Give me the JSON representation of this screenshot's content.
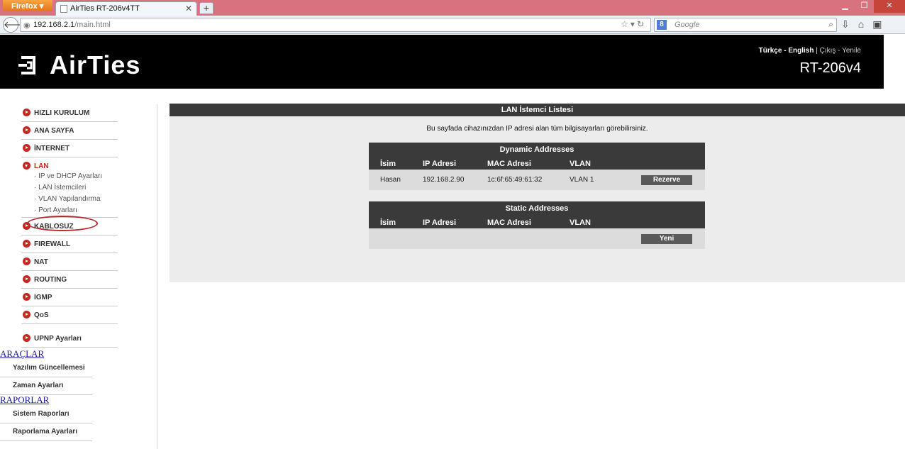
{
  "browser": {
    "menu_button": "Firefox",
    "tab_title": "AirTies RT-206v4TT",
    "url_host": "192.168.2.1",
    "url_path": "/main.html",
    "search_placeholder": "Google",
    "search_engine_glyph": "8"
  },
  "header": {
    "logo_text": "AirTies",
    "lang_turkish": "Türkçe",
    "lang_sep": "-",
    "lang_english": "English",
    "pipe": "|",
    "logout": "Çıkış - Yenile",
    "model": "RT-206v4"
  },
  "sidebar": {
    "menu": [
      {
        "label": "HIZLI KURULUM"
      },
      {
        "label": "ANA SAYFA"
      },
      {
        "label": "İNTERNET"
      },
      {
        "label": "LAN"
      },
      {
        "label": "KABLOSUZ"
      },
      {
        "label": "FIREWALL"
      },
      {
        "label": "NAT"
      },
      {
        "label": "ROUTING"
      },
      {
        "label": "IGMP"
      },
      {
        "label": "QoS"
      },
      {
        "label": "UPNP Ayarları"
      }
    ],
    "lan_sub": [
      "· IP ve DHCP Ayarları",
      "· LAN İstemcileri",
      "· VLAN Yapılandırma",
      "· Port Ayarları"
    ],
    "tools_title": "ARAÇLAR",
    "tools": [
      "Yazılım Güncellemesi",
      "Zaman Ayarları"
    ],
    "reports_title": "RAPORLAR",
    "reports": [
      "Sistem Raporları",
      "Raporlama Ayarları"
    ]
  },
  "content": {
    "title": "LAN İstemci Listesi",
    "description": "Bu sayfada cihazınızdan IP adresi alan tüm bilgisayarları görebilirsiniz.",
    "dynamic": {
      "title": "Dynamic Addresses",
      "columns": [
        "İsim",
        "IP Adresi",
        "MAC Adresi",
        "VLAN"
      ],
      "rows": [
        {
          "name": "Hasan",
          "ip": "192.168.2.90",
          "mac": "1c:6f:65:49:61:32",
          "vlan": "VLAN 1",
          "action": "Rezerve"
        }
      ]
    },
    "static": {
      "title": "Static Addresses",
      "columns": [
        "İsim",
        "IP Adresi",
        "MAC Adresi",
        "VLAN"
      ],
      "new_button": "Yeni"
    }
  },
  "colors": {
    "accent_red": "#c8261e",
    "header_bg": "#000000",
    "table_head_bg": "#3a3a3a",
    "panel_bg": "#ececec",
    "tab_strip": "#d9727f"
  }
}
